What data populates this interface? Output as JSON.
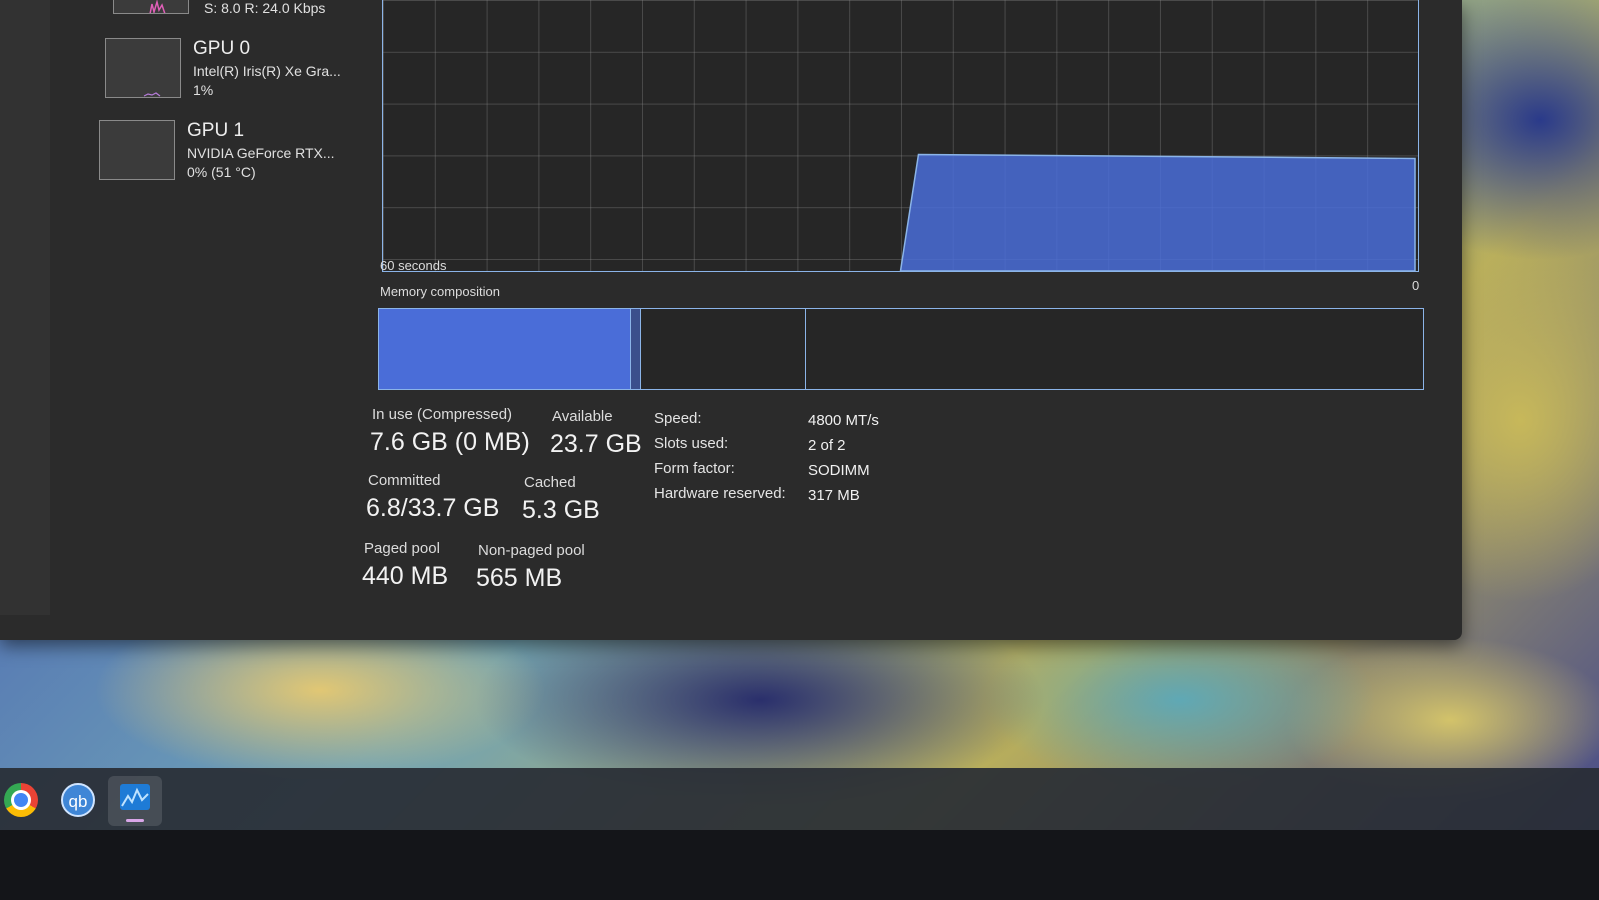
{
  "sidebar": {
    "network_partial": {
      "text": "S: 8.0  R: 24.0 Kbps"
    },
    "gpu0": {
      "title": "GPU 0",
      "subtitle": "Intel(R) Iris(R) Xe Gra...",
      "value": "1%"
    },
    "gpu1": {
      "title": "GPU 1",
      "subtitle": "NVIDIA GeForce RTX...",
      "value": "0%  (51 °C)"
    }
  },
  "graph": {
    "time_label": "60 seconds",
    "zero_label": "0",
    "usage_level_fraction": 0.43,
    "usage_start_fraction": 0.5
  },
  "composition": {
    "label": "Memory composition"
  },
  "stats": {
    "in_use": {
      "label": "In use (Compressed)",
      "value": "7.6 GB (0 MB)"
    },
    "available": {
      "label": "Available",
      "value": "23.7 GB"
    },
    "committed": {
      "label": "Committed",
      "value": "6.8/33.7 GB"
    },
    "cached": {
      "label": "Cached",
      "value": "5.3 GB"
    },
    "paged_pool": {
      "label": "Paged pool",
      "value": "440 MB"
    },
    "non_paged_pool": {
      "label": "Non-paged pool",
      "value": "565 MB"
    }
  },
  "properties": {
    "speed": {
      "label": "Speed:",
      "value": "4800 MT/s"
    },
    "slots": {
      "label": "Slots used:",
      "value": "2 of 2"
    },
    "form_factor": {
      "label": "Form factor:",
      "value": "SODIMM"
    },
    "hardware_reserved": {
      "label": "Hardware reserved:",
      "value": "317 MB"
    }
  },
  "taskbar": {
    "items": [
      {
        "icon": "chrome-icon"
      },
      {
        "icon": "qbittorrent-icon",
        "glyph": "qb"
      },
      {
        "icon": "task-manager-icon",
        "active": true
      }
    ]
  },
  "colors": {
    "graph_fill": "#4a6dd8",
    "graph_line": "#8bb4e8"
  }
}
